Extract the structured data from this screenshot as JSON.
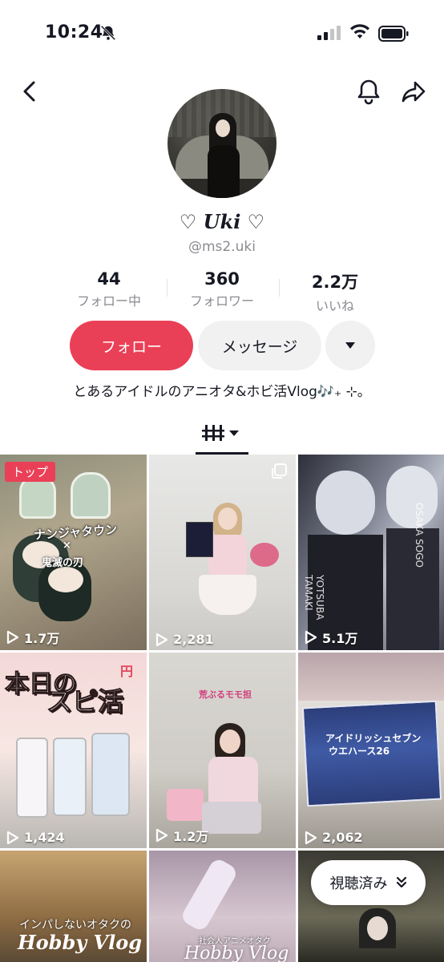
{
  "status_bar": {
    "time": "10:24"
  },
  "profile": {
    "display_name": "♡ Uki ♡",
    "username": "@ms2.uki",
    "stats": [
      {
        "value": "44",
        "label": "フォロー中"
      },
      {
        "value": "360",
        "label": "フォロワー"
      },
      {
        "value": "2.2万",
        "label": "いいね"
      }
    ],
    "follow_label": "フォロー",
    "message_label": "メッセージ",
    "bio": "とあるアイドルのアニオタ&ホビ活Vlog🎶₊ ⊹。"
  },
  "colors": {
    "accent": "#ea4057",
    "secondary_button": "#f1f1f2",
    "muted_text": "#8a8b91"
  },
  "icons": {
    "nav": [
      "back-icon",
      "bell-icon",
      "share-icon"
    ],
    "status": [
      "bell-slash-icon",
      "signal-icon",
      "wifi-icon",
      "battery-icon"
    ],
    "tab": "grid-filter-icon",
    "views": "play-icon",
    "watched": "chevron-double-down-icon"
  },
  "videos": [
    {
      "views": "1.7万",
      "badge": "トップ",
      "overlay": [
        "ナンジャタウン",
        "×",
        "鬼滅の刃"
      ]
    },
    {
      "views": "2,281",
      "multi": true
    },
    {
      "views": "5.1万",
      "overlay": [
        "YOTSUBA TAMAKI",
        "OSAKA SOGO"
      ]
    },
    {
      "views": "1,424",
      "overlay": [
        "本日の",
        "スピ活",
        "円"
      ]
    },
    {
      "views": "1.2万",
      "overlay": [
        "荒ぶるモモ担"
      ]
    },
    {
      "views": "2,062",
      "overlay": [
        "アイドリッシュセブン",
        "ウエハース26"
      ]
    },
    {
      "overlay": [
        "インパしないオタクの",
        "Hobby Vlog"
      ]
    },
    {
      "overlay": [
        "社会人アニメオタク",
        "Hobby Vlog"
      ]
    },
    {}
  ],
  "watched_label": "視聴済み"
}
